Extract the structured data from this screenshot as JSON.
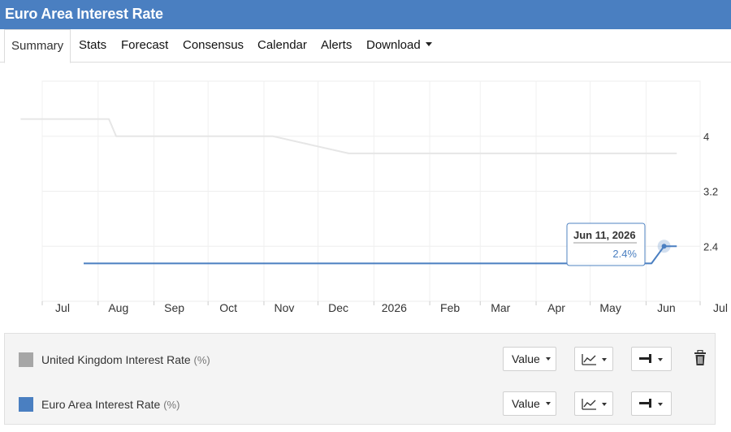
{
  "header": {
    "title": "Euro Area Interest Rate"
  },
  "tabs": [
    {
      "label": "Summary",
      "active": true
    },
    {
      "label": "Stats"
    },
    {
      "label": "Forecast"
    },
    {
      "label": "Consensus"
    },
    {
      "label": "Calendar"
    },
    {
      "label": "Alerts"
    },
    {
      "label": "Download",
      "dropdown": true
    }
  ],
  "chart_data": {
    "type": "line",
    "xlabel": "",
    "ylabel": "",
    "x_tick_labels": [
      "Jul",
      "Aug",
      "Sep",
      "Oct",
      "Nov",
      "Dec",
      "2026",
      "Feb",
      "Mar",
      "Apr",
      "May",
      "Jun",
      "Jul"
    ],
    "y_ticks": [
      2.4,
      3.2,
      4
    ],
    "ylim": [
      1.6,
      4.8
    ],
    "xlim": [
      "2025-07-01",
      "2026-07-01"
    ],
    "grid": true,
    "series": [
      {
        "name": "United Kingdom Interest Rate",
        "color": "#e6e6e6",
        "points": [
          [
            "2025-06-19",
            4.25
          ],
          [
            "2025-08-07",
            4.25
          ],
          [
            "2025-08-11",
            4.0
          ],
          [
            "2025-11-06",
            4.0
          ],
          [
            "2025-12-18",
            3.75
          ],
          [
            "2026-06-18",
            3.75
          ]
        ]
      },
      {
        "name": "Euro Area Interest Rate",
        "color": "#4a7fc1",
        "points": [
          [
            "2025-07-24",
            2.15
          ],
          [
            "2026-06-04",
            2.15
          ],
          [
            "2026-06-11",
            2.4
          ],
          [
            "2026-06-18",
            2.4
          ]
        ]
      }
    ],
    "tooltip": {
      "date": "Jun 11, 2026",
      "value": "2.4%"
    }
  },
  "legend": {
    "rows": [
      {
        "name": "United Kingdom Interest Rate",
        "unit": "(%)",
        "color": "#a6a6a6",
        "value_label": "Value",
        "deletable": true
      },
      {
        "name": "Euro Area Interest Rate",
        "unit": "(%)",
        "color": "#4a7fc1",
        "value_label": "Value",
        "deletable": false
      }
    ]
  }
}
